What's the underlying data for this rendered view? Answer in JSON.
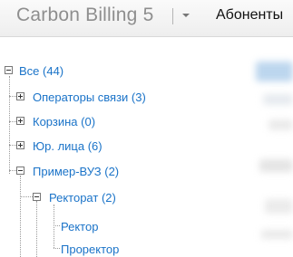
{
  "header": {
    "brand": "Carbon Billing 5",
    "nav_label": "Абоненты"
  },
  "tree": {
    "root": {
      "label": "Все (44)",
      "state": "expanded"
    },
    "items": [
      {
        "label": "Операторы связи (3)",
        "state": "collapsed"
      },
      {
        "label": "Корзина (0)",
        "state": "collapsed"
      },
      {
        "label": "Юр. лица (6)",
        "state": "collapsed"
      },
      {
        "label": "Пример-ВУЗ (2)",
        "state": "expanded"
      }
    ],
    "sub": {
      "label": "Ректорат (2)",
      "state": "expanded"
    },
    "leaves": [
      {
        "label": "Ректор"
      },
      {
        "label": "Проректор"
      }
    ]
  },
  "colors": {
    "link": "#1a73c8",
    "brand_text": "#8e8e8e"
  }
}
